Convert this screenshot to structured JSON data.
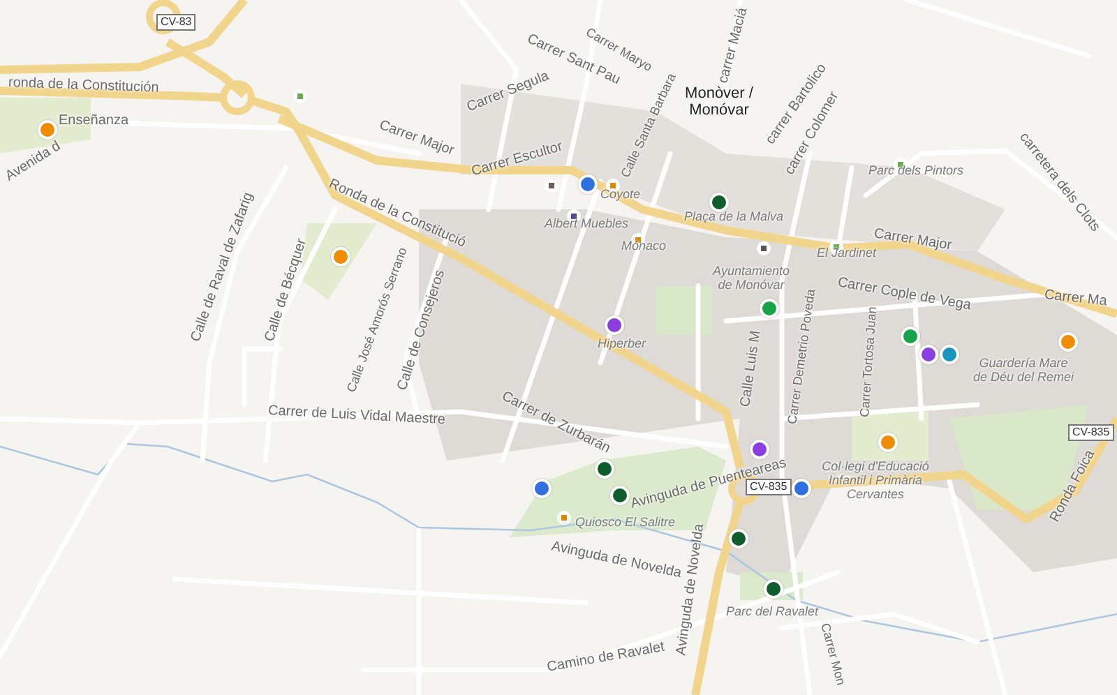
{
  "map": {
    "labels": [
      {
        "text": "CV-83",
        "kind": "road_badge"
      },
      {
        "text": "ronda de la Constitución",
        "kind": "street"
      },
      {
        "text": "Avenida d",
        "kind": "street"
      },
      {
        "text": "Enseñanza",
        "kind": "street"
      },
      {
        "text": "Ronda de la Constitució",
        "kind": "street"
      },
      {
        "text": "Calle de Raval de Zafarig",
        "kind": "street"
      },
      {
        "text": "Calle de Bécquer",
        "kind": "street"
      },
      {
        "text": "Calle José Amorós Serrano",
        "kind": "street"
      },
      {
        "text": "Calle de Consejeros",
        "kind": "street"
      },
      {
        "text": "Carrer de Luis Vidal Maestre",
        "kind": "street"
      },
      {
        "text": "Carrer de Zurbarán",
        "kind": "street"
      },
      {
        "text": "Avinguda de Puenteareas",
        "kind": "street"
      },
      {
        "text": "Quiosco El Salitre",
        "kind": "poi"
      },
      {
        "text": "Avinguda de Novelda",
        "kind": "street"
      },
      {
        "text": "Avinguda de Novelda",
        "kind": "street"
      },
      {
        "text": "Camino de Ravalet",
        "kind": "street"
      },
      {
        "text": "Carrer Segula",
        "kind": "street"
      },
      {
        "text": "Carrer Major",
        "kind": "street"
      },
      {
        "text": "Carrer Escultor",
        "kind": "street"
      },
      {
        "text": "Carrer Sant Pau",
        "kind": "street"
      },
      {
        "text": "Carrer Maryo",
        "kind": "street"
      },
      {
        "text": "Calle Santa Barbara",
        "kind": "street"
      },
      {
        "text": "carrer Maciá",
        "kind": "street"
      },
      {
        "text": "Monòver /\nMonóvar",
        "kind": "place"
      },
      {
        "text": "carrer Bartolico",
        "kind": "street"
      },
      {
        "text": "carrer Colomer",
        "kind": "street"
      },
      {
        "text": "Parc dels Pintors",
        "kind": "poi"
      },
      {
        "text": "carretera dels Clots",
        "kind": "street"
      },
      {
        "text": "Coyote",
        "kind": "poi"
      },
      {
        "text": "Albert Muebles",
        "kind": "poi"
      },
      {
        "text": "Mónaco",
        "kind": "poi"
      },
      {
        "text": "Plaça de la Malva",
        "kind": "poi"
      },
      {
        "text": "Ayuntamiento\nde Monóvar",
        "kind": "poi"
      },
      {
        "text": "El Jardinet",
        "kind": "poi"
      },
      {
        "text": "Carrer Major",
        "kind": "street"
      },
      {
        "text": "Carrer Cople de Vega",
        "kind": "street"
      },
      {
        "text": "Carrer Ma",
        "kind": "street"
      },
      {
        "text": "Hiperber",
        "kind": "poi"
      },
      {
        "text": "Calle Luis M",
        "kind": "street"
      },
      {
        "text": "Carrer Demetrio Poveda",
        "kind": "street"
      },
      {
        "text": "Carrer Tortosa Juan",
        "kind": "street"
      },
      {
        "text": "Guardería Mare\nde Déu del Remei",
        "kind": "poi"
      },
      {
        "text": "Col·legi d'Educació\nInfantil i Primària\nCervantes",
        "kind": "poi"
      },
      {
        "text": "CV-835",
        "kind": "road_badge"
      },
      {
        "text": "CV-835",
        "kind": "road_badge"
      },
      {
        "text": "Ronda Foica",
        "kind": "street"
      },
      {
        "text": "Parc del Ravalet",
        "kind": "poi"
      },
      {
        "text": "Carrer Mon",
        "kind": "street"
      }
    ],
    "pins": [
      {
        "color": "#f08c00"
      },
      {
        "color": "#f08c00"
      },
      {
        "color": "#2f6fe0"
      },
      {
        "color": "#0f5c2e"
      },
      {
        "color": "#8a3ee0"
      },
      {
        "color": "#17a34a"
      },
      {
        "color": "#17a34a"
      },
      {
        "color": "#8a3ee0"
      },
      {
        "color": "#1a95c0"
      },
      {
        "color": "#f08c00"
      },
      {
        "color": "#8a3ee0"
      },
      {
        "color": "#f08c00"
      },
      {
        "color": "#2f6fe0"
      },
      {
        "color": "#2f6fe0"
      },
      {
        "color": "#0f5c2e"
      },
      {
        "color": "#0f5c2e"
      },
      {
        "color": "#0f5c2e"
      },
      {
        "color": "#0f5c2e"
      }
    ]
  }
}
